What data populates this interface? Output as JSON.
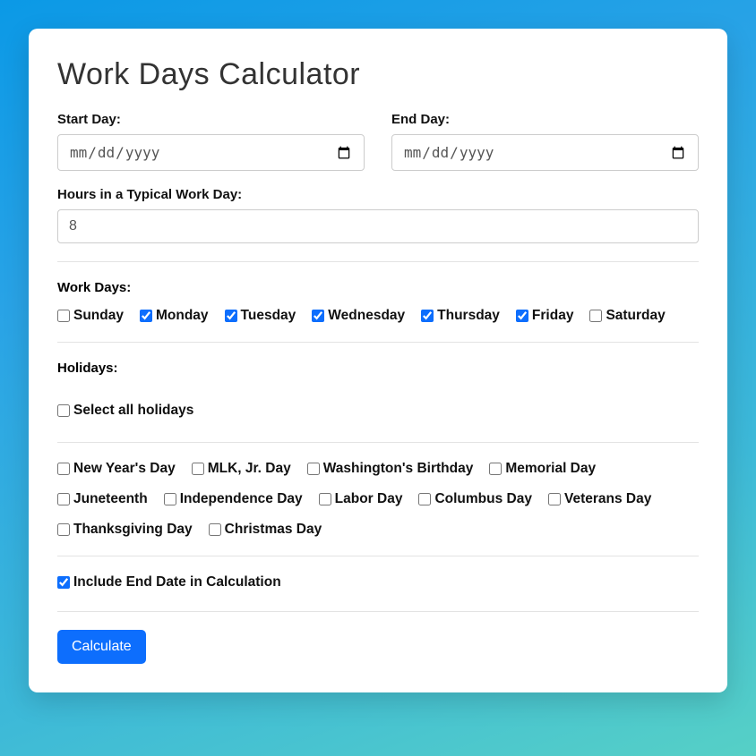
{
  "title": "Work Days Calculator",
  "fields": {
    "start_day_label": "Start Day:",
    "end_day_label": "End Day:",
    "date_placeholder": "mm/dd/yyyy",
    "hours_label": "Hours in a Typical Work Day:",
    "hours_value": "8"
  },
  "workdays": {
    "label": "Work Days:",
    "days": [
      {
        "label": "Sunday",
        "checked": false
      },
      {
        "label": "Monday",
        "checked": true
      },
      {
        "label": "Tuesday",
        "checked": true
      },
      {
        "label": "Wednesday",
        "checked": true
      },
      {
        "label": "Thursday",
        "checked": true
      },
      {
        "label": "Friday",
        "checked": true
      },
      {
        "label": "Saturday",
        "checked": false
      }
    ]
  },
  "holidays": {
    "label": "Holidays:",
    "select_all_label": "Select all holidays",
    "select_all_checked": false,
    "items": [
      {
        "label": "New Year's Day",
        "checked": false
      },
      {
        "label": "MLK, Jr. Day",
        "checked": false
      },
      {
        "label": "Washington's Birthday",
        "checked": false
      },
      {
        "label": "Memorial Day",
        "checked": false
      },
      {
        "label": "Juneteenth",
        "checked": false
      },
      {
        "label": "Independence Day",
        "checked": false
      },
      {
        "label": "Labor Day",
        "checked": false
      },
      {
        "label": "Columbus Day",
        "checked": false
      },
      {
        "label": "Veterans Day",
        "checked": false
      },
      {
        "label": "Thanksgiving Day",
        "checked": false
      },
      {
        "label": "Christmas Day",
        "checked": false
      }
    ]
  },
  "include_end": {
    "label": "Include End Date in Calculation",
    "checked": true
  },
  "actions": {
    "calculate_label": "Calculate"
  }
}
